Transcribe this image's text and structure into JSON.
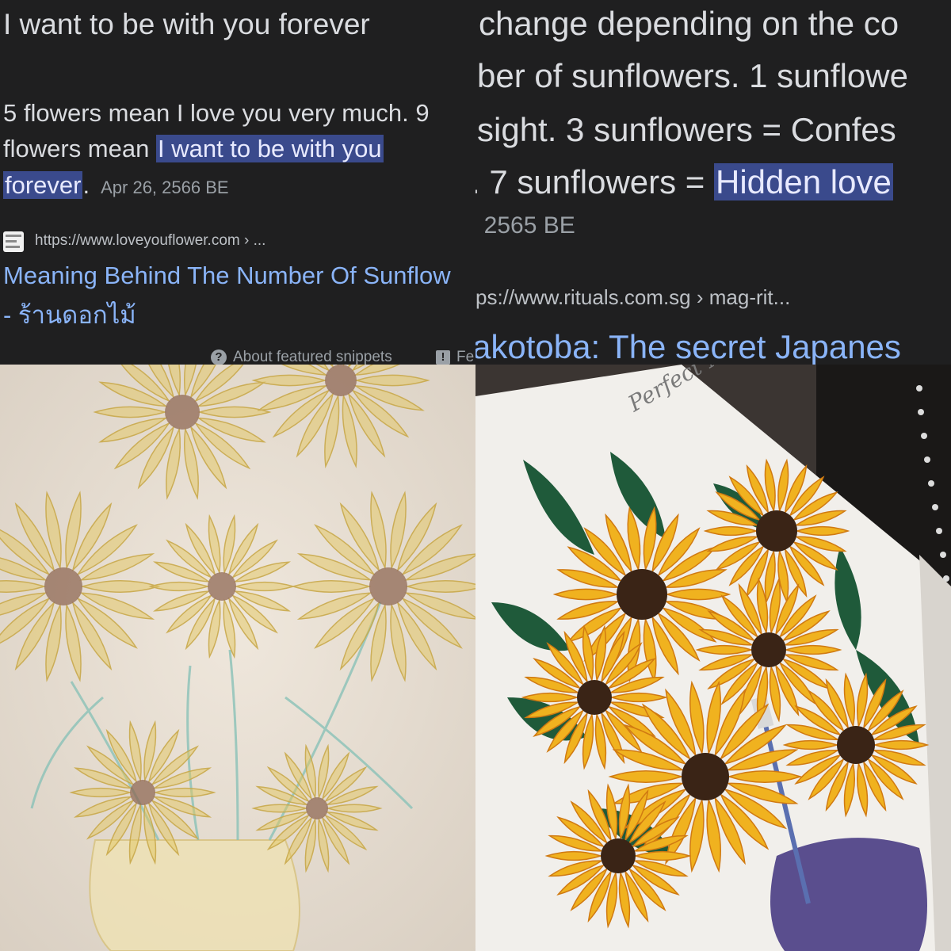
{
  "top_left": {
    "title": "I want to be with you forever",
    "snippet_line1": "5 flowers mean I love you very much. 9",
    "snippet_line2_prefix": "flowers mean ",
    "snippet_highlight_part1": "I want to be with you",
    "snippet_highlight_part2": "forever",
    "snippet_end": ".",
    "date": "Apr 26, 2566 BE",
    "url": "https://www.loveyouflower.com › ...",
    "result_title_line1": "Meaning Behind The Number Of Sunflow",
    "result_title_line2": "- ร้านดอกไม้",
    "about_label": "About featured snippets",
    "feedback_label": "Fe"
  },
  "top_right": {
    "line1": "change depending on the co",
    "line2": "ber of sunflowers. 1 sunflowe",
    "line3": "sight. 3 sunflowers = Confes",
    "line4_prefix": ". 7 sunflowers = ",
    "line4_highlight": "Hidden love",
    "date": ", 2565 BE",
    "url": "ps://www.rituals.com.sg › mag-rit...",
    "result_title": "akotoba: The secret Japanes"
  },
  "bottom_left": {
    "description": "pencil-sketch-sunflowers"
  },
  "bottom_right": {
    "canvas_text": "Perfect Match",
    "description": "acrylic-painting-sunflowers-in-vase"
  },
  "colors": {
    "background": "#1f1f20",
    "text": "#dadce0",
    "link": "#8ab4f8",
    "highlight": "#3a4a8c",
    "meta": "#9aa0a6"
  }
}
